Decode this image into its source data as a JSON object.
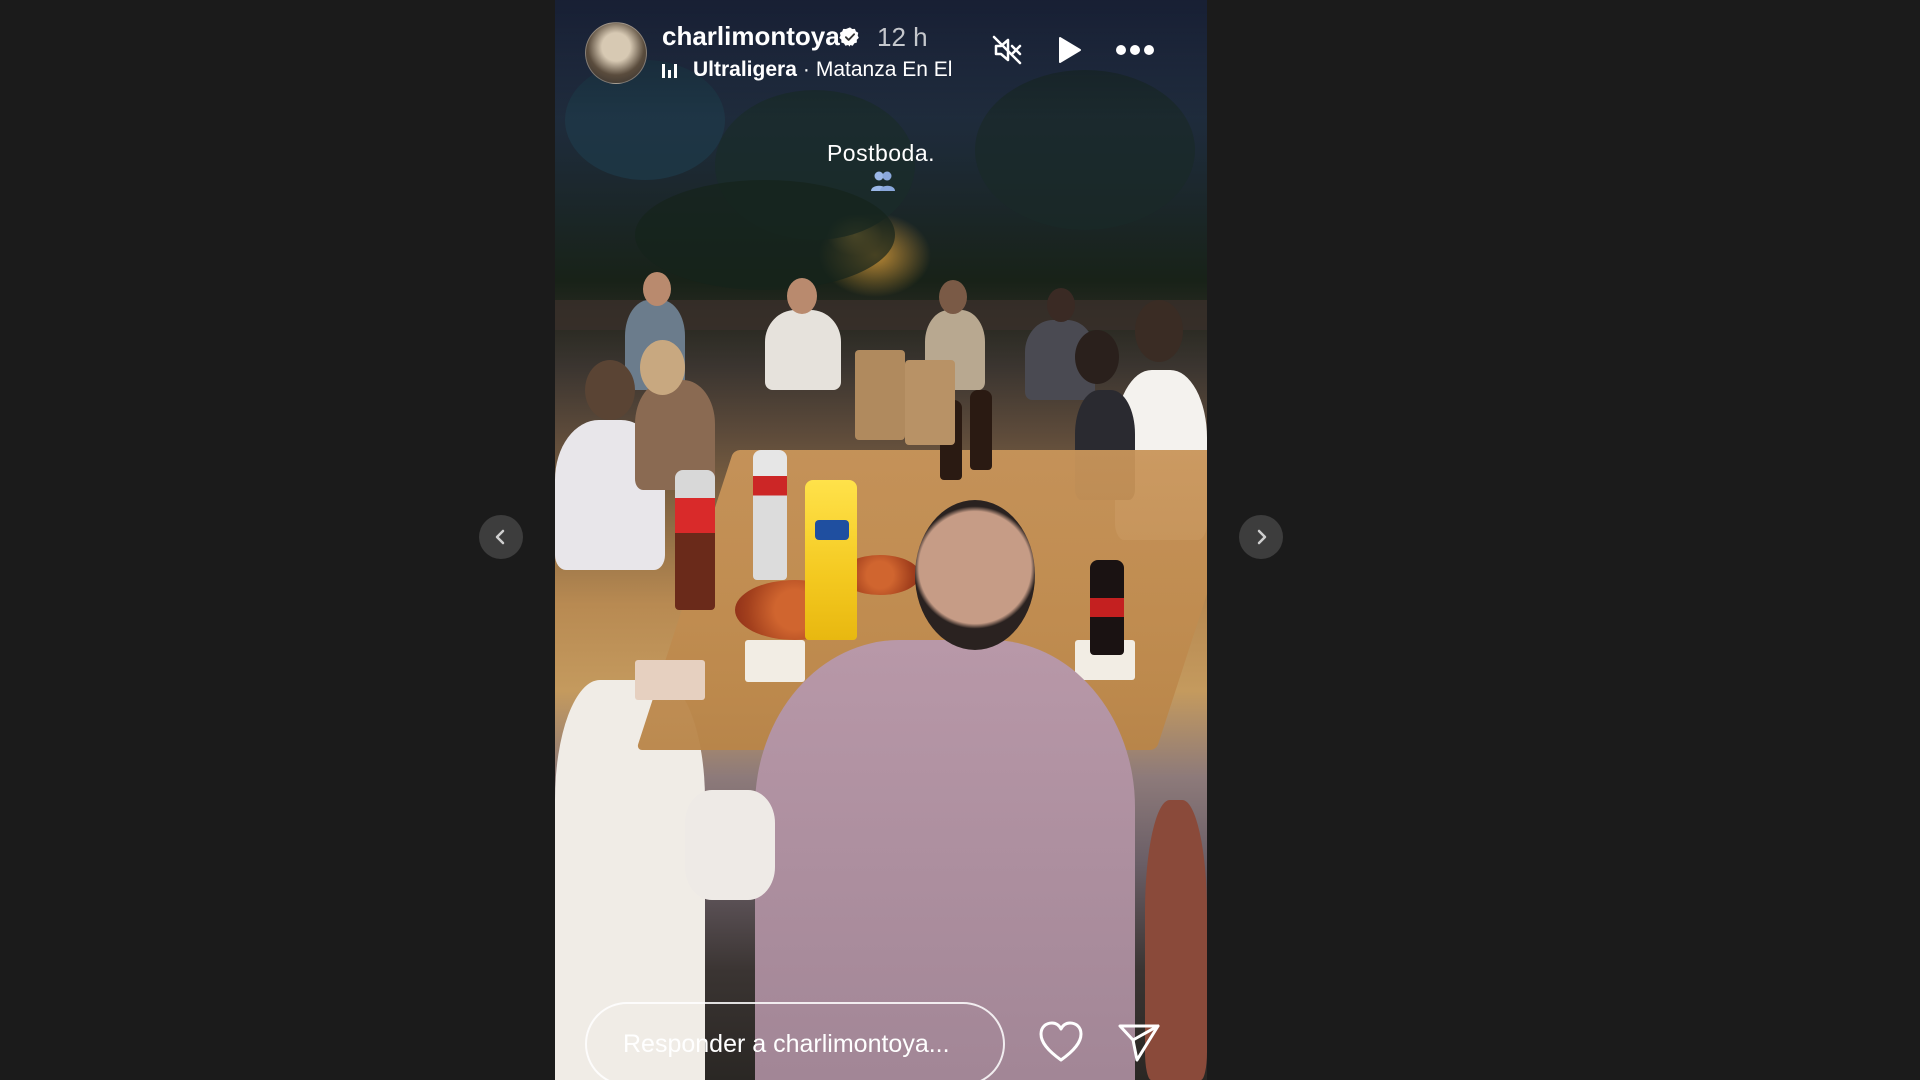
{
  "story": {
    "username": "charlimontoya",
    "time_ago": "12 h",
    "music": {
      "song": "Ultraligera",
      "separator": "·",
      "artist": "Matanza En El"
    },
    "caption": "Postboda.",
    "caption_emoji": "two-people-emoji",
    "controls": {
      "mute_icon": "speaker-muted-icon",
      "play_icon": "play-icon",
      "more_icon": "more-dots-icon"
    },
    "reply_placeholder": "Responder a charlimontoya...",
    "like_icon": "heart-icon",
    "share_icon": "send-icon"
  },
  "navigation": {
    "prev_icon": "chevron-left-icon",
    "next_icon": "chevron-right-icon"
  },
  "colors": {
    "page_background": "#1b1b1b",
    "nav_button": "#3d3d3d",
    "verified_badge": "#ffffff",
    "text": "#ffffff"
  }
}
